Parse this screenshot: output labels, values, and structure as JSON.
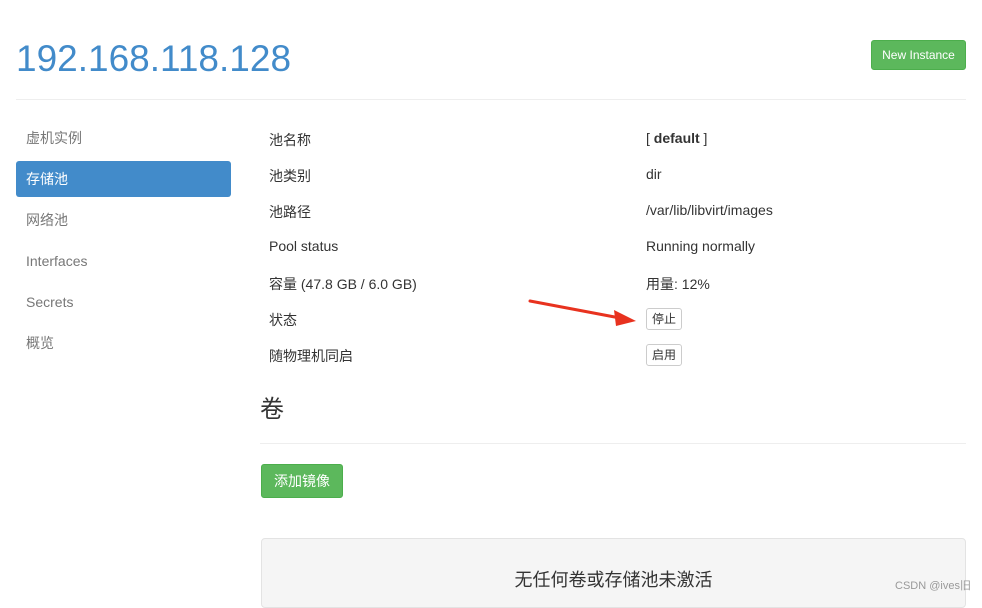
{
  "header": {
    "host": "192.168.118.128",
    "new_instance_label": "New Instance"
  },
  "sidebar": {
    "items": [
      {
        "label": "虚机实例",
        "active": false
      },
      {
        "label": "存储池",
        "active": true
      },
      {
        "label": "网络池",
        "active": false
      },
      {
        "label": "Interfaces",
        "active": false
      },
      {
        "label": "Secrets",
        "active": false
      },
      {
        "label": "概览",
        "active": false
      }
    ]
  },
  "pool_info": {
    "name_label": "池名称",
    "name_prefix": "[ ",
    "name_value": "default",
    "name_suffix": " ]",
    "type_label": "池类别",
    "type_value": "dir",
    "path_label": "池路径",
    "path_value": "/var/lib/libvirt/images",
    "status_label": "Pool status",
    "status_value": "Running normally",
    "capacity_label": "容量 (47.8 GB / 6.0 GB)",
    "usage_value": "用量: 12%",
    "state_label": "状态",
    "stop_button": "停止",
    "autostart_label": "随物理机同启",
    "enable_button": "启用"
  },
  "volumes": {
    "title": "卷",
    "add_image_button": "添加镜像",
    "empty_message": "无任何卷或存储池未激活"
  },
  "annotation": {
    "arrow_color": "#e8321f"
  },
  "watermark": "CSDN @ives旧"
}
